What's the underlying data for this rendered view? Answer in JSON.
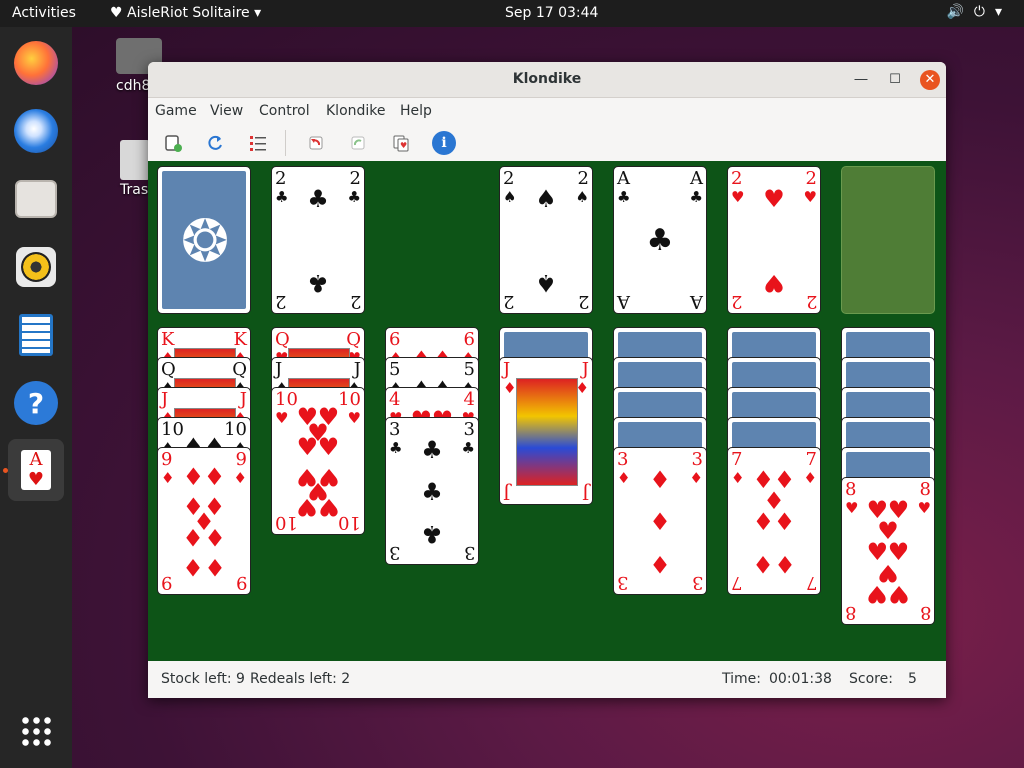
{
  "topbar": {
    "activities": "Activities",
    "app_menu": "AisleRiot Solitaire",
    "clock": "Sep 17  03:44"
  },
  "desktop": {
    "home_label": "cdh8",
    "trash_label": "Tras"
  },
  "dock": {
    "apps": [
      "firefox-icon",
      "thunderbird-icon",
      "files-icon",
      "rhythmbox-icon",
      "writer-icon",
      "help-icon",
      "aisleriot-icon",
      "show-apps-icon"
    ]
  },
  "window": {
    "title": "Klondike",
    "menu": [
      "Game",
      "View",
      "Control",
      "Klondike",
      "Help"
    ]
  },
  "game": {
    "stock": {
      "back": true
    },
    "waste": {
      "rank": "2",
      "suit": "♣",
      "color": "black"
    },
    "foundations": [
      {
        "rank": "2",
        "suit": "♠",
        "color": "black"
      },
      {
        "rank": "A",
        "suit": "♣",
        "color": "black"
      },
      {
        "rank": "2",
        "suit": "♥",
        "color": "red"
      },
      {
        "rank": "",
        "suit": "",
        "color": "empty"
      }
    ],
    "tableau": [
      {
        "down": 0,
        "up": [
          {
            "rank": "K",
            "suit": "♦",
            "color": "red"
          },
          {
            "rank": "Q",
            "suit": "♠",
            "color": "black"
          },
          {
            "rank": "J",
            "suit": "♦",
            "color": "red"
          },
          {
            "rank": "10",
            "suit": "♠",
            "color": "black"
          },
          {
            "rank": "9",
            "suit": "♦",
            "color": "red"
          }
        ]
      },
      {
        "down": 0,
        "up": [
          {
            "rank": "Q",
            "suit": "♥",
            "color": "red"
          },
          {
            "rank": "J",
            "suit": "♠",
            "color": "black"
          },
          {
            "rank": "10",
            "suit": "♥",
            "color": "red"
          }
        ]
      },
      {
        "down": 0,
        "up": [
          {
            "rank": "6",
            "suit": "♦",
            "color": "red"
          },
          {
            "rank": "5",
            "suit": "♠",
            "color": "black"
          },
          {
            "rank": "4",
            "suit": "♥",
            "color": "red"
          },
          {
            "rank": "3",
            "suit": "♣",
            "color": "black"
          }
        ]
      },
      {
        "down": 1,
        "up": [
          {
            "rank": "J",
            "suit": "♦",
            "color": "red"
          }
        ]
      },
      {
        "down": 4,
        "up": [
          {
            "rank": "3",
            "suit": "♦",
            "color": "red"
          }
        ]
      },
      {
        "down": 4,
        "up": [
          {
            "rank": "7",
            "suit": "♦",
            "color": "red"
          }
        ]
      },
      {
        "down": 5,
        "up": [
          {
            "rank": "8",
            "suit": "♥",
            "color": "red"
          }
        ]
      }
    ]
  },
  "status": {
    "stock": "Stock left: 9",
    "redeals": "Redeals left: 2",
    "time_label": "Time:",
    "time_value": "00:01:38",
    "score_label": "Score:",
    "score_value": "5"
  }
}
